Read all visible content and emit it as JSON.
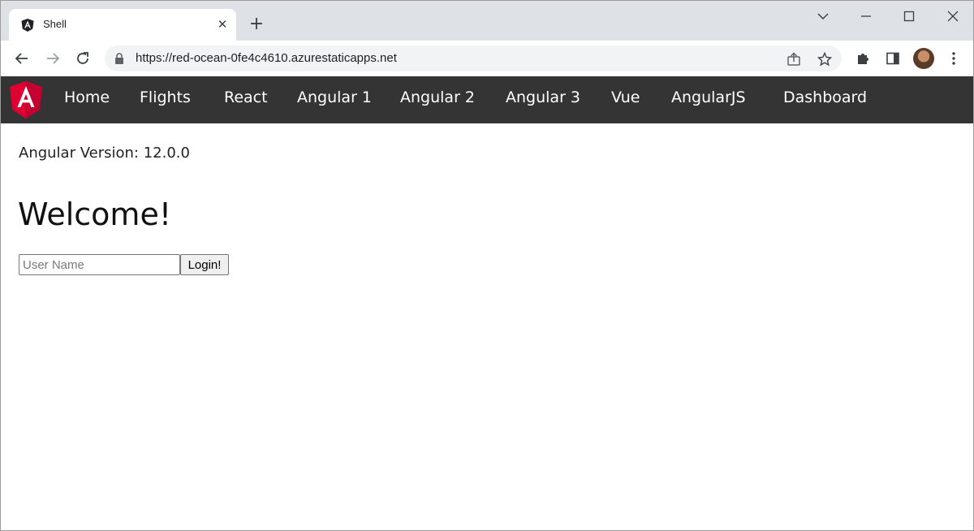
{
  "browser": {
    "tab": {
      "title": "Shell",
      "favicon": "angular-logo-icon"
    },
    "address": {
      "url": "https://red-ocean-0fe4c4610.azurestaticapps.net"
    },
    "icons": {
      "back": "back-arrow-icon",
      "forward": "forward-arrow-icon",
      "reload": "reload-icon",
      "share": "share-icon",
      "bookmark": "star-icon",
      "extensions": "puzzle-icon",
      "side_panel": "side-panel-icon",
      "menu": "kebab-menu-icon"
    }
  },
  "nav": {
    "logo_letter": "A",
    "items": [
      {
        "label": "Home"
      },
      {
        "label": "Flights"
      },
      {
        "label": "React"
      },
      {
        "label": "Angular 1"
      },
      {
        "label": "Angular 2"
      },
      {
        "label": "Angular 3"
      },
      {
        "label": "Vue"
      },
      {
        "label": "AngularJS"
      },
      {
        "label": "Dashboard"
      }
    ]
  },
  "content": {
    "version_label": "Angular Version:",
    "version_value": "12.0.0",
    "heading": "Welcome!",
    "username_placeholder": "User Name",
    "username_value": "",
    "login_label": "Login!"
  },
  "colors": {
    "nav_bg": "#343434",
    "angular_red": "#dd0031",
    "tabstrip_bg": "#dee1e6"
  }
}
